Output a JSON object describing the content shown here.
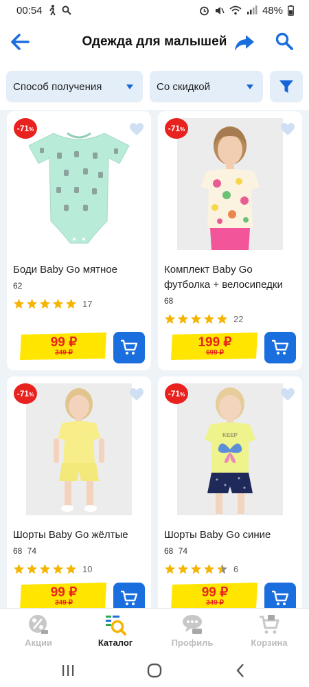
{
  "status_bar": {
    "time": "00:54",
    "battery": "48%"
  },
  "header": {
    "title": "Одежда для малышей"
  },
  "filters": {
    "delivery_label": "Способ получения",
    "discount_label": "Со скидкой"
  },
  "products": [
    {
      "discount": "-71",
      "discount_unit": "%",
      "name": "Боди Baby Go мятное",
      "sizes": "62",
      "rating": 5,
      "reviews": "17",
      "price": "99 ₽",
      "old_price": "349 ₽",
      "image": "mint-bodysuit"
    },
    {
      "discount": "-71",
      "discount_unit": "%",
      "name": "Комплект Baby Go футболка + велосипедки",
      "sizes": "68",
      "rating": 5,
      "reviews": "22",
      "price": "199 ₽",
      "old_price": "699 ₽",
      "image": "girl-floral-tshirt-pink-leggings"
    },
    {
      "discount": "-71",
      "discount_unit": "%",
      "name": "Шорты Baby Go жёлтые",
      "sizes": "68  74",
      "rating": 5,
      "reviews": "10",
      "price": "99 ₽",
      "old_price": "349 ₽",
      "image": "girl-yellow-set"
    },
    {
      "discount": "-71",
      "discount_unit": "%",
      "name": "Шорты Baby Go синие",
      "sizes": "68  74",
      "rating": 4.5,
      "reviews": "6",
      "price": "99 ₽",
      "old_price": "349 ₽",
      "image": "girl-butterfly-tshirt-navy-shorts",
      "tshirt_text": "KEEP"
    }
  ],
  "bottom_nav": {
    "items": [
      {
        "label": "Акции",
        "icon": "percent-icon",
        "active": false
      },
      {
        "label": "Каталог",
        "icon": "catalog-search-icon",
        "active": true
      },
      {
        "label": "Профиль",
        "icon": "profile-icon",
        "active": false
      },
      {
        "label": "Корзина",
        "icon": "cart-icon",
        "active": false
      }
    ]
  },
  "colors": {
    "accent_blue": "#1a6ede",
    "sale_red": "#e8221f",
    "price_yellow": "#ffe500",
    "star_yellow": "#f5b400",
    "page_bg": "#eef3f8"
  }
}
